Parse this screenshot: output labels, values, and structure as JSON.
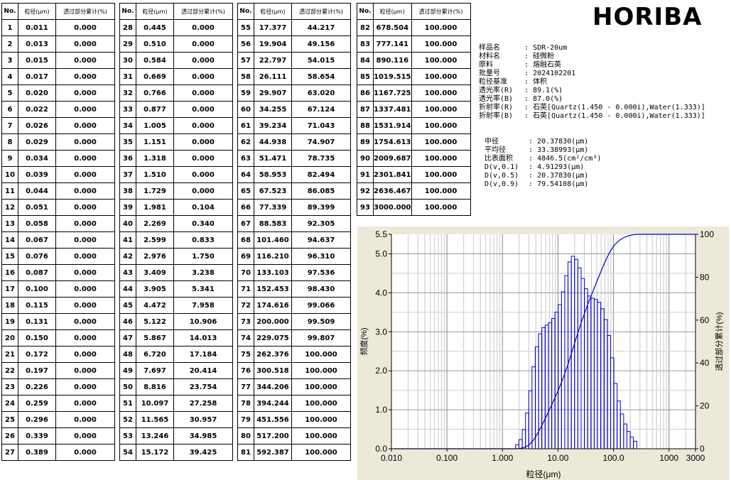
{
  "logo": "HORIBA",
  "table": {
    "headers": [
      "No.",
      "粒径(μm)",
      "透过部分累计(%)"
    ],
    "rows": [
      [
        "1",
        "0.011",
        "0.000"
      ],
      [
        "2",
        "0.013",
        "0.000"
      ],
      [
        "3",
        "0.015",
        "0.000"
      ],
      [
        "4",
        "0.017",
        "0.000"
      ],
      [
        "5",
        "0.020",
        "0.000"
      ],
      [
        "6",
        "0.022",
        "0.000"
      ],
      [
        "7",
        "0.026",
        "0.000"
      ],
      [
        "8",
        "0.029",
        "0.000"
      ],
      [
        "9",
        "0.034",
        "0.000"
      ],
      [
        "10",
        "0.039",
        "0.000"
      ],
      [
        "11",
        "0.044",
        "0.000"
      ],
      [
        "12",
        "0.051",
        "0.000"
      ],
      [
        "13",
        "0.058",
        "0.000"
      ],
      [
        "14",
        "0.067",
        "0.000"
      ],
      [
        "15",
        "0.076",
        "0.000"
      ],
      [
        "16",
        "0.087",
        "0.000"
      ],
      [
        "17",
        "0.100",
        "0.000"
      ],
      [
        "18",
        "0.115",
        "0.000"
      ],
      [
        "19",
        "0.131",
        "0.000"
      ],
      [
        "20",
        "0.150",
        "0.000"
      ],
      [
        "21",
        "0.172",
        "0.000"
      ],
      [
        "22",
        "0.197",
        "0.000"
      ],
      [
        "23",
        "0.226",
        "0.000"
      ],
      [
        "24",
        "0.259",
        "0.000"
      ],
      [
        "25",
        "0.296",
        "0.000"
      ],
      [
        "26",
        "0.339",
        "0.000"
      ],
      [
        "27",
        "0.389",
        "0.000"
      ],
      [
        "28",
        "0.445",
        "0.000"
      ],
      [
        "29",
        "0.510",
        "0.000"
      ],
      [
        "30",
        "0.584",
        "0.000"
      ],
      [
        "31",
        "0.669",
        "0.000"
      ],
      [
        "32",
        "0.766",
        "0.000"
      ],
      [
        "33",
        "0.877",
        "0.000"
      ],
      [
        "34",
        "1.005",
        "0.000"
      ],
      [
        "35",
        "1.151",
        "0.000"
      ],
      [
        "36",
        "1.318",
        "0.000"
      ],
      [
        "37",
        "1.510",
        "0.000"
      ],
      [
        "38",
        "1.729",
        "0.000"
      ],
      [
        "39",
        "1.981",
        "0.104"
      ],
      [
        "40",
        "2.269",
        "0.340"
      ],
      [
        "41",
        "2.599",
        "0.833"
      ],
      [
        "42",
        "2.976",
        "1.750"
      ],
      [
        "43",
        "3.409",
        "3.238"
      ],
      [
        "44",
        "3.905",
        "5.341"
      ],
      [
        "45",
        "4.472",
        "7.958"
      ],
      [
        "46",
        "5.122",
        "10.906"
      ],
      [
        "47",
        "5.867",
        "14.013"
      ],
      [
        "48",
        "6.720",
        "17.184"
      ],
      [
        "49",
        "7.697",
        "20.414"
      ],
      [
        "50",
        "8.816",
        "23.754"
      ],
      [
        "51",
        "10.097",
        "27.258"
      ],
      [
        "52",
        "11.565",
        "30.957"
      ],
      [
        "53",
        "13.246",
        "34.985"
      ],
      [
        "54",
        "15.172",
        "39.425"
      ],
      [
        "55",
        "17.377",
        "44.217"
      ],
      [
        "56",
        "19.904",
        "49.156"
      ],
      [
        "57",
        "22.797",
        "54.015"
      ],
      [
        "58",
        "26.111",
        "58.654"
      ],
      [
        "59",
        "29.907",
        "63.020"
      ],
      [
        "60",
        "34.255",
        "67.124"
      ],
      [
        "61",
        "39.234",
        "71.043"
      ],
      [
        "62",
        "44.938",
        "74.907"
      ],
      [
        "63",
        "51.471",
        "78.735"
      ],
      [
        "64",
        "58.953",
        "82.494"
      ],
      [
        "65",
        "67.523",
        "86.085"
      ],
      [
        "66",
        "77.339",
        "89.399"
      ],
      [
        "67",
        "88.583",
        "92.305"
      ],
      [
        "68",
        "101.460",
        "94.637"
      ],
      [
        "69",
        "116.210",
        "96.310"
      ],
      [
        "70",
        "133.103",
        "97.536"
      ],
      [
        "71",
        "152.453",
        "98.430"
      ],
      [
        "72",
        "174.616",
        "99.066"
      ],
      [
        "73",
        "200.000",
        "99.509"
      ],
      [
        "74",
        "229.075",
        "99.807"
      ],
      [
        "75",
        "262.376",
        "100.000"
      ],
      [
        "76",
        "300.518",
        "100.000"
      ],
      [
        "77",
        "344.206",
        "100.000"
      ],
      [
        "78",
        "394.244",
        "100.000"
      ],
      [
        "79",
        "451.556",
        "100.000"
      ],
      [
        "80",
        "517.200",
        "100.000"
      ],
      [
        "81",
        "592.387",
        "100.000"
      ],
      [
        "82",
        "678.504",
        "100.000"
      ],
      [
        "83",
        "777.141",
        "100.000"
      ],
      [
        "84",
        "890.116",
        "100.000"
      ],
      [
        "85",
        "1019.515",
        "100.000"
      ],
      [
        "86",
        "1167.725",
        "100.000"
      ],
      [
        "87",
        "1337.481",
        "100.000"
      ],
      [
        "88",
        "1531.914",
        "100.000"
      ],
      [
        "89",
        "1754.613",
        "100.000"
      ],
      [
        "90",
        "2009.687",
        "100.000"
      ],
      [
        "91",
        "2301.841",
        "100.000"
      ],
      [
        "92",
        "2636.467",
        "100.000"
      ],
      [
        "93",
        "3000.000",
        "100.000"
      ]
    ]
  },
  "sample_info": [
    {
      "label": "样品名",
      "value": "SDR-20um"
    },
    {
      "label": "材料名",
      "value": "硅微粉"
    },
    {
      "label": "原料",
      "value": "熔融石英"
    },
    {
      "label": "批量号",
      "value": "2024102201"
    },
    {
      "label": "粒径基准",
      "value": "体积"
    },
    {
      "label": "透光率(R)",
      "value": "89.1(%)"
    },
    {
      "label": "透光率(B)",
      "value": "87.0(%)"
    },
    {
      "label": "折射率(R)",
      "value": "石英[Quartz(1.450 - 0.000i),Water(1.333)]"
    },
    {
      "label": "折射率(B)",
      "value": "石英[Quartz(1.450 - 0.000i),Water(1.333)]"
    }
  ],
  "results": [
    {
      "label": "中径",
      "value": "20.37830(μm)"
    },
    {
      "label": "平均径",
      "value": "33.38993(μm)"
    },
    {
      "label": "比表面积",
      "value": "4846.5(cm²/cm³)"
    },
    {
      "label": "D(v,0.1)",
      "value": "4.91293(μm)"
    },
    {
      "label": "D(v,0.5)",
      "value": "20.37830(μm)"
    },
    {
      "label": "D(v,0.9)",
      "value": "79.54108(μm)"
    }
  ],
  "chart_data": {
    "type": "bar",
    "xlabel": "粒径(μm)",
    "ylabel": "频度(%)",
    "y2label": "透过部分累计(%)",
    "x_scale": "log",
    "xlim": [
      0.01,
      3000
    ],
    "ylim": [
      0,
      5.5
    ],
    "y2lim": [
      0,
      100
    ],
    "x_ticks": [
      "0.010",
      "0.100",
      "1.000",
      "10.00",
      "100.0",
      "1000",
      "3000"
    ],
    "y_ticks": [
      "0.0",
      "1.0",
      "2.0",
      "3.0",
      "4.0",
      "5.0",
      "5.5"
    ],
    "y2_ticks": [
      "0",
      "20",
      "40",
      "60",
      "80",
      "100"
    ],
    "grid": true,
    "bar_color": "#0000cc",
    "line_color": "#0000cc",
    "panel_color": "#ece9d8"
  }
}
